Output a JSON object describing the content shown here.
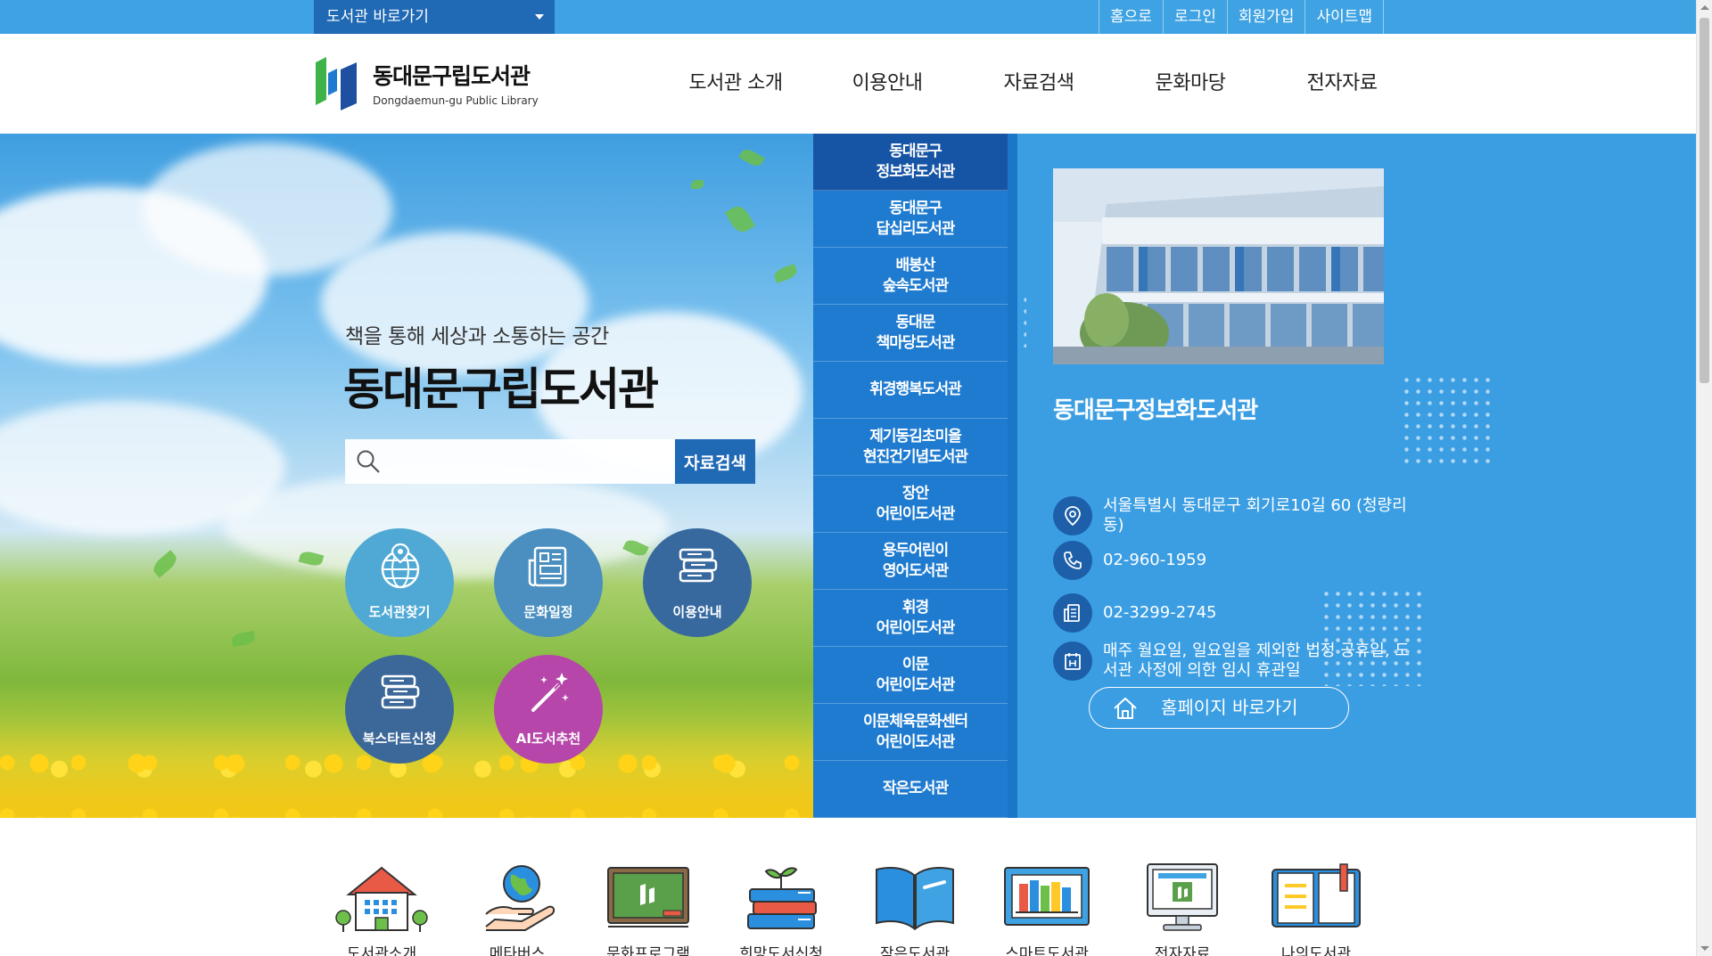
{
  "topbar": {
    "library_select": "도서관 바로가기",
    "links": [
      "홈으로",
      "로그인",
      "회원가입",
      "사이트맵"
    ]
  },
  "header": {
    "logo_ko": "동대문구립도서관",
    "logo_en": "Dongdaemun-gu Public Library",
    "nav": [
      "도서관 소개",
      "이용안내",
      "자료검색",
      "문화마당",
      "전자자료"
    ]
  },
  "hero": {
    "subtitle": "책을 통해 세상과 소통하는 공간",
    "title": "동대문구립도서관",
    "search_placeholder": "",
    "search_button": "자료검색",
    "quick": [
      {
        "label": "도서관찾기",
        "icon": "globe-pin-icon",
        "color": "#4fa9d4"
      },
      {
        "label": "문화일정",
        "icon": "newspaper-icon",
        "color": "#4a8fc0"
      },
      {
        "label": "이용안내",
        "icon": "book-stack-icon",
        "color": "#37699f"
      },
      {
        "label": "북스타트신청",
        "icon": "book-stack-icon",
        "color": "#3c6899"
      },
      {
        "label": "AI도서추천",
        "icon": "magic-wand-icon",
        "color": "#b646a9"
      }
    ]
  },
  "branches": [
    {
      "line1": "동대문구",
      "line2": "정보화도서관",
      "active": true
    },
    {
      "line1": "동대문구",
      "line2": "답십리도서관"
    },
    {
      "line1": "배봉산",
      "line2": "숲속도서관"
    },
    {
      "line1": "동대문",
      "line2": "책마당도서관"
    },
    {
      "line1": "휘경행복도서관",
      "line2": ""
    },
    {
      "line1": "제기동김초미올",
      "line2": "현진건기념도서관"
    },
    {
      "line1": "장안",
      "line2": "어린이도서관"
    },
    {
      "line1": "용두어린이",
      "line2": "영어도서관"
    },
    {
      "line1": "휘경",
      "line2": "어린이도서관"
    },
    {
      "line1": "이문",
      "line2": "어린이도서관"
    },
    {
      "line1": "이문체육문화센터",
      "line2": "어린이도서관"
    },
    {
      "line1": "작은도서관",
      "line2": ""
    }
  ],
  "info": {
    "name": "동대문구정보화도서관",
    "address": "서울특별시 동대문구 회기로10길 60 (청량리동)",
    "phone": "02-960-1959",
    "fax": "02-3299-2745",
    "closed": "매주 월요일, 일요일을 제외한 법정 공휴일, 도서관 사정에 의한 임시 휴관일",
    "home_button": "홈페이지 바로가기"
  },
  "bottom_menu": [
    {
      "label": "도서관소개",
      "icon": "library-building-icon"
    },
    {
      "label": "메타버스",
      "icon": "globe-hand-icon"
    },
    {
      "label": "문화프로그램",
      "icon": "chalkboard-icon"
    },
    {
      "label": "희망도서신청",
      "icon": "books-sprout-icon"
    },
    {
      "label": "작은도서관",
      "icon": "open-book-icon"
    },
    {
      "label": "스마트도서관",
      "icon": "bookshelf-screen-icon"
    },
    {
      "label": "전자자료",
      "icon": "monitor-icon"
    },
    {
      "label": "나의도서관",
      "icon": "notebook-icon"
    }
  ],
  "colors": {
    "topbar": "#3fa3e3",
    "select": "#1f69b5",
    "branch_list": "#1f7bd0",
    "branch_active": "#1655a5",
    "info_panel": "#3b9ee3"
  }
}
